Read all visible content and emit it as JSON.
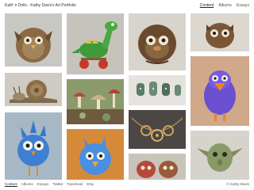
{
  "site": {
    "title": "Kath' n Dolls - Kathy Davis's Art Portfolio"
  },
  "nav": {
    "items": [
      "Content",
      "Albums",
      "Essays"
    ],
    "active": "Content"
  },
  "footer": {
    "nav": [
      "Content",
      "Albums",
      "Essays",
      "Twitter",
      "Facebook",
      "Etsy"
    ],
    "copyright": "© Kathy Davis"
  },
  "gallery": {
    "items": [
      {
        "subject": "furry owl doll"
      },
      {
        "subject": "green dinosaur on wheels"
      },
      {
        "subject": "brown furry creature"
      },
      {
        "subject": "furry creature with big eyes"
      },
      {
        "subject": "snail sculpture"
      },
      {
        "subject": "mushroom fairy garden"
      },
      {
        "subject": "ceramic bead sculptures"
      },
      {
        "subject": "blue bird doll"
      },
      {
        "subject": "blue fuzzy bird"
      },
      {
        "subject": "blue bird with orange beak"
      },
      {
        "subject": "steampunk gear necklace"
      },
      {
        "subject": "goblin doll"
      },
      {
        "subject": "creature head sculptures"
      }
    ]
  }
}
